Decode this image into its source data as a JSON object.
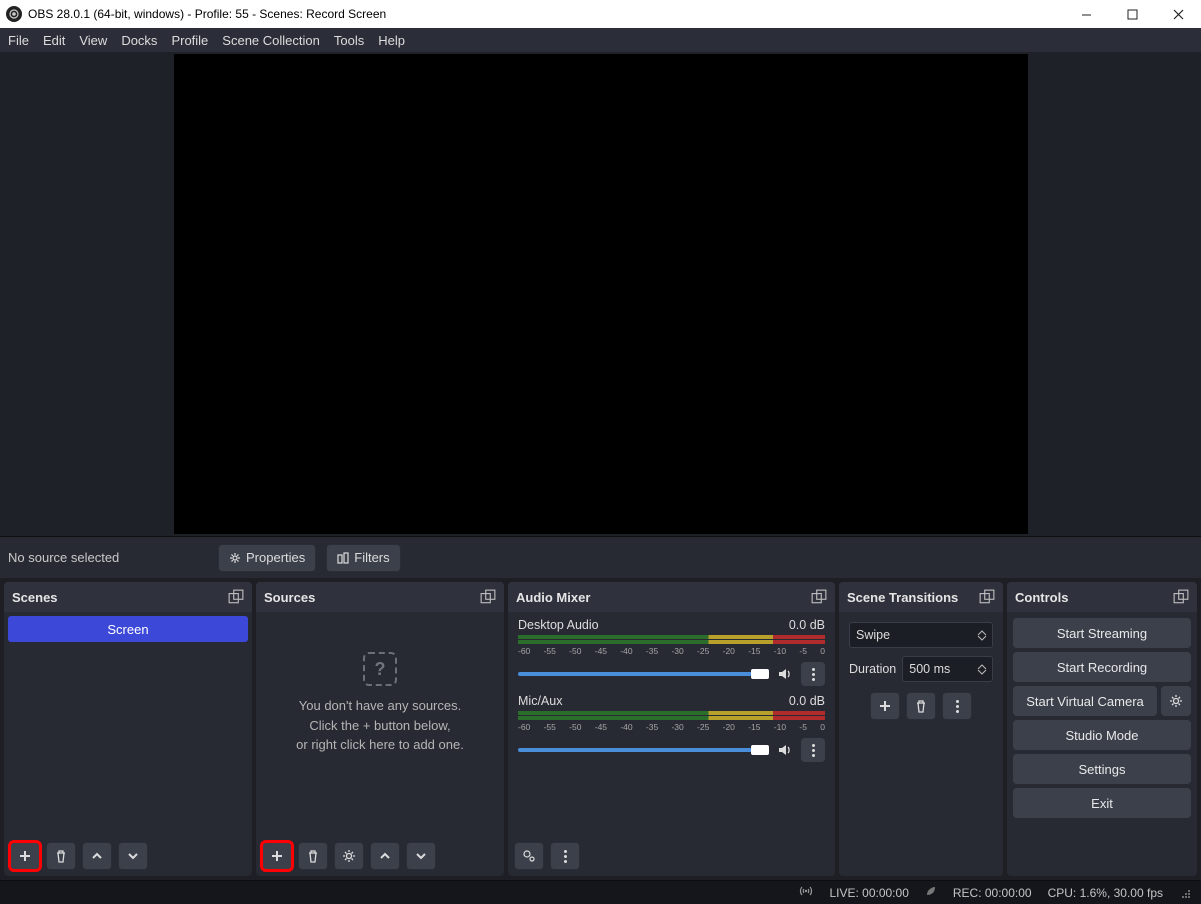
{
  "title": "OBS 28.0.1 (64-bit, windows) - Profile: 55 - Scenes: Record Screen",
  "menu": [
    "File",
    "Edit",
    "View",
    "Docks",
    "Profile",
    "Scene Collection",
    "Tools",
    "Help"
  ],
  "source_bar": {
    "label": "No source selected",
    "properties": "Properties",
    "filters": "Filters"
  },
  "panels": {
    "scenes": {
      "title": "Scenes",
      "items": [
        "Screen"
      ]
    },
    "sources": {
      "title": "Sources",
      "empty1": "You don't have any sources.",
      "empty2": "Click the + button below,",
      "empty3": "or right click here to add one."
    },
    "audio": {
      "title": "Audio Mixer",
      "ticks": [
        "-60",
        "-55",
        "-50",
        "-45",
        "-40",
        "-35",
        "-30",
        "-25",
        "-20",
        "-15",
        "-10",
        "-5",
        "0"
      ],
      "ch": [
        {
          "name": "Desktop Audio",
          "db": "0.0 dB"
        },
        {
          "name": "Mic/Aux",
          "db": "0.0 dB"
        }
      ]
    },
    "transitions": {
      "title": "Scene Transitions",
      "current": "Swipe",
      "dur_label": "Duration",
      "dur_value": "500 ms"
    },
    "controls": {
      "title": "Controls",
      "buttons": [
        "Start Streaming",
        "Start Recording",
        "Start Virtual Camera",
        "Studio Mode",
        "Settings",
        "Exit"
      ]
    }
  },
  "status": {
    "live": "LIVE: 00:00:00",
    "rec": "REC: 00:00:00",
    "cpu": "CPU: 1.6%, 30.00 fps"
  }
}
